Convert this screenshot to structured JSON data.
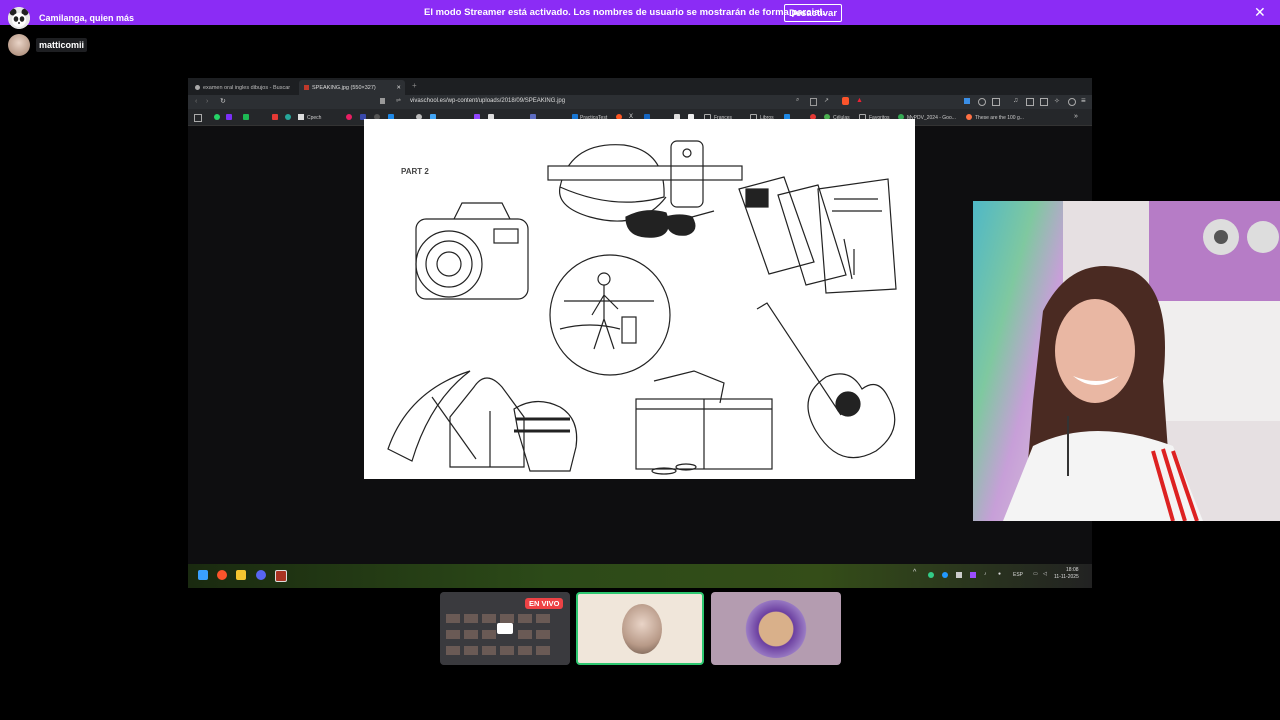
{
  "streamer_banner": {
    "message": "El modo Streamer está activado. Los nombres de usuario se mostrarán de forma parcial.",
    "button_label": "Desactivar",
    "close_icon": "close-icon",
    "color": "#8b2cf5"
  },
  "voice_users": [
    {
      "name": "Camilanga, quien más",
      "avatar": "panda-avatar"
    },
    {
      "name": "matticomii",
      "avatar": "doll-avatar"
    }
  ],
  "browser": {
    "tabs": [
      {
        "label": "examen oral ingles dibujos - Buscar",
        "active": false
      },
      {
        "label": "SPEAKING.jpg (550×327)",
        "active": true
      }
    ],
    "new_tab": "+",
    "url": "vivaschool.es/wp-content/uploads/2018/09/SPEAKING.jpg",
    "bookmarks": [
      "Cpech",
      "PracticaTest",
      "Frances",
      "Libros",
      "Células",
      "Favoritos",
      "MyPDV_2024 - Goo...",
      "These are the 100 g..."
    ],
    "image": {
      "heading": "PART 2"
    }
  },
  "taskbar": {
    "tray_lang": "ESP",
    "time": "18:08",
    "date": "11-11-2025"
  },
  "stage": {
    "live_badge": "EN VIVO"
  }
}
